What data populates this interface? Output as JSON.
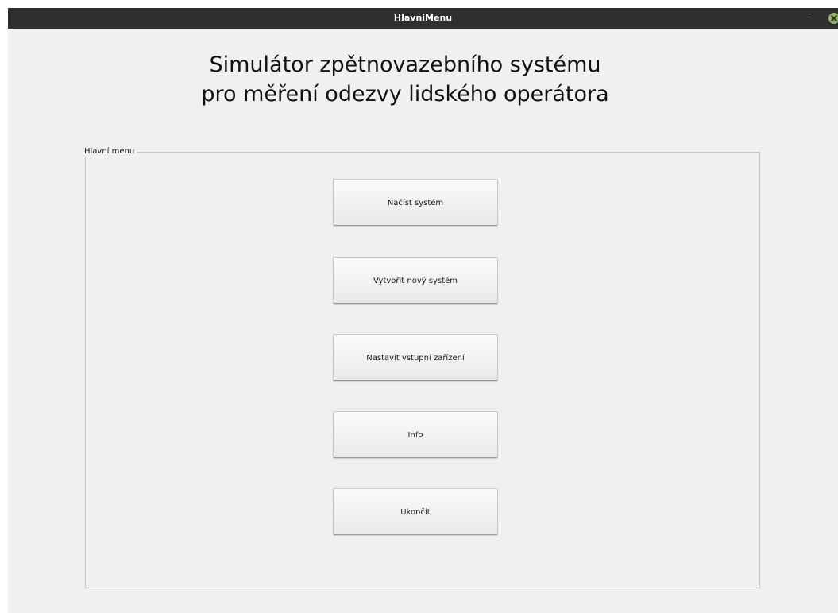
{
  "window": {
    "title": "HlavniMenu",
    "minimize_symbol": "–",
    "close_icon": "close-icon",
    "close_color": "#8fb95f"
  },
  "heading": {
    "line1": "Simulátor zpětnovazebního systému",
    "line2": "pro měření odezvy lidského operátora"
  },
  "group": {
    "title": "Hlavní menu"
  },
  "buttons": {
    "load": "Načíst systém",
    "create": "Vytvořit nový systém",
    "input_devices": "Nastavit vstupní zařízení",
    "info": "Info",
    "quit": "Ukončit"
  }
}
